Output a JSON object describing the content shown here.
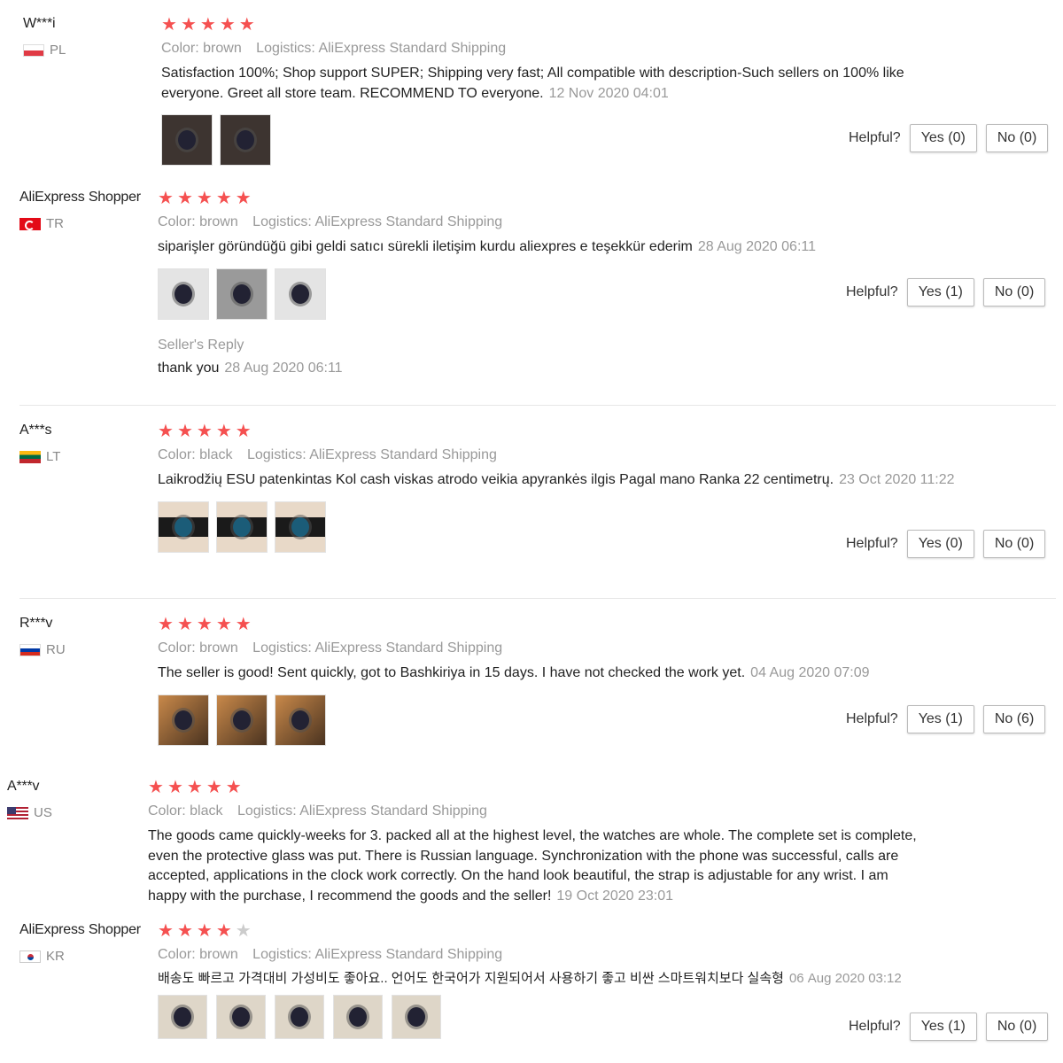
{
  "labels": {
    "color": "Color:",
    "logistics": "Logistics:",
    "helpful": "Helpful?",
    "sellers_reply": "Seller's Reply"
  },
  "reviews": [
    {
      "user": "W***i",
      "country": "PL",
      "rating": 5,
      "color": "brown",
      "logistics": "AliExpress Standard Shipping",
      "text": "Satisfaction 100%; Shop support SUPER; Shipping very fast; All compatible with description-Such sellers on 100% like everyone. Greet all store team. RECOMMEND TO everyone.",
      "date": "12 Nov 2020 04:01",
      "yes": "Yes (0)",
      "no": "No (0)"
    },
    {
      "user": "AliExpress Shopper",
      "country": "TR",
      "rating": 5,
      "color": "brown",
      "logistics": "AliExpress Standard Shipping",
      "text": "siparişler göründüğü gibi geldi satıcı sürekli iletişim kurdu aliexpres e teşekkür ederim",
      "date": "28 Aug 2020 06:11",
      "yes": "Yes (1)",
      "no": "No (0)",
      "reply": {
        "text": "thank you",
        "date": "28 Aug 2020 06:11"
      }
    },
    {
      "user": "A***s",
      "country": "LT",
      "rating": 5,
      "color": "black",
      "logistics": "AliExpress Standard Shipping",
      "text": "Laikrodžių ESU patenkintas Kol cash viskas atrodo veikia apyrankės ilgis Pagal mano Ranka 22 centimetrų.",
      "date": "23 Oct 2020 11:22",
      "yes": "Yes (0)",
      "no": "No (0)"
    },
    {
      "user": "R***v",
      "country": "RU",
      "rating": 5,
      "color": "brown",
      "logistics": "AliExpress Standard Shipping",
      "text": "The seller is good! Sent quickly, got to Bashkiriya in 15 days. I have not checked the work yet.",
      "date": "04 Aug 2020 07:09",
      "yes": "Yes (1)",
      "no": "No (6)"
    },
    {
      "user": "A***v",
      "country": "US",
      "rating": 5,
      "color": "black",
      "logistics": "AliExpress Standard Shipping",
      "text": "The goods came quickly-weeks for 3. packed all at the highest level, the watches are whole. The complete set is complete, even the protective glass was put. There is Russian language. Synchronization with the phone was successful, calls are accepted, applications in the clock work correctly. On the hand look beautiful, the strap is adjustable for any wrist. I am happy with the purchase, I recommend the goods and the seller!",
      "date": "19 Oct 2020 23:01"
    },
    {
      "user": "AliExpress Shopper",
      "country": "KR",
      "rating": 4,
      "color": "brown",
      "logistics": "AliExpress Standard Shipping",
      "text": "배송도 빠르고 가격대비 가성비도 좋아요.. 언어도 한국어가 지원되어서 사용하기 좋고 비싼 스마트워치보다 실속형",
      "date": "06 Aug 2020 03:12",
      "yes": "Yes (1)",
      "no": "No (0)"
    }
  ]
}
